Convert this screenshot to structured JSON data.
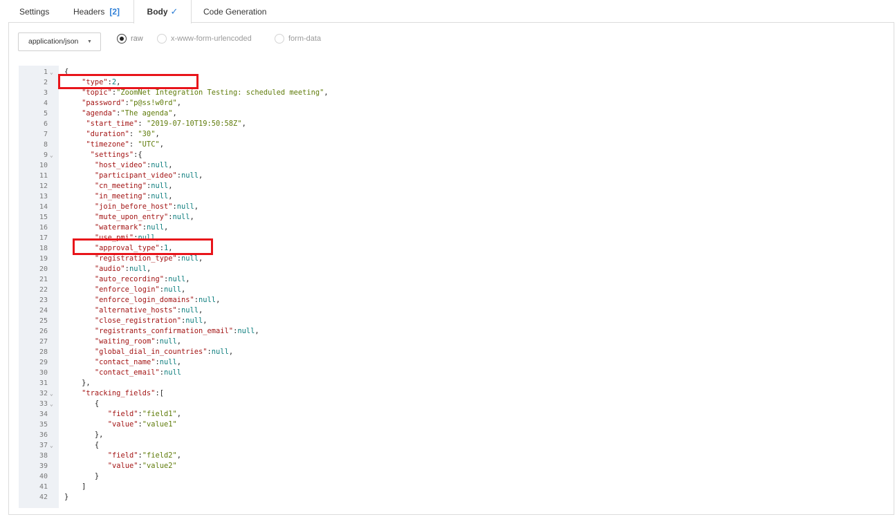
{
  "tabs": {
    "settings": "Settings",
    "headers": "Headers",
    "headers_count": "[2]",
    "body": "Body",
    "body_check": "✓",
    "code_generation": "Code Generation"
  },
  "body_options": {
    "content_type": "application/json",
    "raw": "raw",
    "urlencoded": "x-www-form-urlencoded",
    "form_data": "form-data",
    "selected": "raw"
  },
  "editor": {
    "lines": [
      {
        "n": "1",
        "fold": true,
        "indent": 0,
        "parts": [
          [
            "p",
            "{"
          ]
        ]
      },
      {
        "n": "2",
        "fold": false,
        "indent": 4,
        "parts": [
          [
            "k",
            "\"type\""
          ],
          [
            "p",
            ":"
          ],
          [
            "n",
            "2"
          ],
          [
            "p",
            ","
          ]
        ]
      },
      {
        "n": "3",
        "fold": false,
        "indent": 4,
        "parts": [
          [
            "k",
            "\"topic\""
          ],
          [
            "p",
            ":"
          ],
          [
            "s",
            "\"ZoomNet Integration Testing: scheduled meeting\""
          ],
          [
            "p",
            ","
          ]
        ]
      },
      {
        "n": "4",
        "fold": false,
        "indent": 4,
        "parts": [
          [
            "k",
            "\"password\""
          ],
          [
            "p",
            ":"
          ],
          [
            "s",
            "\"p@ss!w0rd\""
          ],
          [
            "p",
            ","
          ]
        ]
      },
      {
        "n": "5",
        "fold": false,
        "indent": 4,
        "parts": [
          [
            "k",
            "\"agenda\""
          ],
          [
            "p",
            ":"
          ],
          [
            "s",
            "\"The agenda\""
          ],
          [
            "p",
            ","
          ]
        ]
      },
      {
        "n": "6",
        "fold": false,
        "indent": 5,
        "parts": [
          [
            "k",
            "\"start_time\""
          ],
          [
            "p",
            ": "
          ],
          [
            "s",
            "\"2019-07-10T19:50:58Z\""
          ],
          [
            "p",
            ","
          ]
        ]
      },
      {
        "n": "7",
        "fold": false,
        "indent": 5,
        "parts": [
          [
            "k",
            "\"duration\""
          ],
          [
            "p",
            ": "
          ],
          [
            "s",
            "\"30\""
          ],
          [
            "p",
            ","
          ]
        ]
      },
      {
        "n": "8",
        "fold": false,
        "indent": 5,
        "parts": [
          [
            "k",
            "\"timezone\""
          ],
          [
            "p",
            ": "
          ],
          [
            "s",
            "\"UTC\""
          ],
          [
            "p",
            ","
          ]
        ]
      },
      {
        "n": "9",
        "fold": true,
        "indent": 6,
        "parts": [
          [
            "k",
            "\"settings\""
          ],
          [
            "p",
            ":{"
          ]
        ]
      },
      {
        "n": "10",
        "fold": false,
        "indent": 7,
        "parts": [
          [
            "k",
            "\"host_video\""
          ],
          [
            "p",
            ":"
          ],
          [
            "n",
            "null"
          ],
          [
            "p",
            ","
          ]
        ]
      },
      {
        "n": "11",
        "fold": false,
        "indent": 7,
        "parts": [
          [
            "k",
            "\"participant_video\""
          ],
          [
            "p",
            ":"
          ],
          [
            "n",
            "null"
          ],
          [
            "p",
            ","
          ]
        ]
      },
      {
        "n": "12",
        "fold": false,
        "indent": 7,
        "parts": [
          [
            "k",
            "\"cn_meeting\""
          ],
          [
            "p",
            ":"
          ],
          [
            "n",
            "null"
          ],
          [
            "p",
            ","
          ]
        ]
      },
      {
        "n": "13",
        "fold": false,
        "indent": 7,
        "parts": [
          [
            "k",
            "\"in_meeting\""
          ],
          [
            "p",
            ":"
          ],
          [
            "n",
            "null"
          ],
          [
            "p",
            ","
          ]
        ]
      },
      {
        "n": "14",
        "fold": false,
        "indent": 7,
        "parts": [
          [
            "k",
            "\"join_before_host\""
          ],
          [
            "p",
            ":"
          ],
          [
            "n",
            "null"
          ],
          [
            "p",
            ","
          ]
        ]
      },
      {
        "n": "15",
        "fold": false,
        "indent": 7,
        "parts": [
          [
            "k",
            "\"mute_upon_entry\""
          ],
          [
            "p",
            ":"
          ],
          [
            "n",
            "null"
          ],
          [
            "p",
            ","
          ]
        ]
      },
      {
        "n": "16",
        "fold": false,
        "indent": 7,
        "parts": [
          [
            "k",
            "\"watermark\""
          ],
          [
            "p",
            ":"
          ],
          [
            "n",
            "null"
          ],
          [
            "p",
            ","
          ]
        ]
      },
      {
        "n": "17",
        "fold": false,
        "indent": 7,
        "parts": [
          [
            "k",
            "\"use_pmi\""
          ],
          [
            "p",
            ":"
          ],
          [
            "n",
            "null"
          ],
          [
            "p",
            ","
          ]
        ]
      },
      {
        "n": "18",
        "fold": false,
        "indent": 7,
        "parts": [
          [
            "k",
            "\"approval_type\""
          ],
          [
            "p",
            ":"
          ],
          [
            "n",
            "1"
          ],
          [
            "p",
            ","
          ]
        ]
      },
      {
        "n": "19",
        "fold": false,
        "indent": 7,
        "parts": [
          [
            "k",
            "\"registration_type\""
          ],
          [
            "p",
            ":"
          ],
          [
            "n",
            "null"
          ],
          [
            "p",
            ","
          ]
        ]
      },
      {
        "n": "20",
        "fold": false,
        "indent": 7,
        "parts": [
          [
            "k",
            "\"audio\""
          ],
          [
            "p",
            ":"
          ],
          [
            "n",
            "null"
          ],
          [
            "p",
            ","
          ]
        ]
      },
      {
        "n": "21",
        "fold": false,
        "indent": 7,
        "parts": [
          [
            "k",
            "\"auto_recording\""
          ],
          [
            "p",
            ":"
          ],
          [
            "n",
            "null"
          ],
          [
            "p",
            ","
          ]
        ]
      },
      {
        "n": "22",
        "fold": false,
        "indent": 7,
        "parts": [
          [
            "k",
            "\"enforce_login\""
          ],
          [
            "p",
            ":"
          ],
          [
            "n",
            "null"
          ],
          [
            "p",
            ","
          ]
        ]
      },
      {
        "n": "23",
        "fold": false,
        "indent": 7,
        "parts": [
          [
            "k",
            "\"enforce_login_domains\""
          ],
          [
            "p",
            ":"
          ],
          [
            "n",
            "null"
          ],
          [
            "p",
            ","
          ]
        ]
      },
      {
        "n": "24",
        "fold": false,
        "indent": 7,
        "parts": [
          [
            "k",
            "\"alternative_hosts\""
          ],
          [
            "p",
            ":"
          ],
          [
            "n",
            "null"
          ],
          [
            "p",
            ","
          ]
        ]
      },
      {
        "n": "25",
        "fold": false,
        "indent": 7,
        "parts": [
          [
            "k",
            "\"close_registration\""
          ],
          [
            "p",
            ":"
          ],
          [
            "n",
            "null"
          ],
          [
            "p",
            ","
          ]
        ]
      },
      {
        "n": "26",
        "fold": false,
        "indent": 7,
        "parts": [
          [
            "k",
            "\"registrants_confirmation_email\""
          ],
          [
            "p",
            ":"
          ],
          [
            "n",
            "null"
          ],
          [
            "p",
            ","
          ]
        ]
      },
      {
        "n": "27",
        "fold": false,
        "indent": 7,
        "parts": [
          [
            "k",
            "\"waiting_room\""
          ],
          [
            "p",
            ":"
          ],
          [
            "n",
            "null"
          ],
          [
            "p",
            ","
          ]
        ]
      },
      {
        "n": "28",
        "fold": false,
        "indent": 7,
        "parts": [
          [
            "k",
            "\"global_dial_in_countries\""
          ],
          [
            "p",
            ":"
          ],
          [
            "n",
            "null"
          ],
          [
            "p",
            ","
          ]
        ]
      },
      {
        "n": "29",
        "fold": false,
        "indent": 7,
        "parts": [
          [
            "k",
            "\"contact_name\""
          ],
          [
            "p",
            ":"
          ],
          [
            "n",
            "null"
          ],
          [
            "p",
            ","
          ]
        ]
      },
      {
        "n": "30",
        "fold": false,
        "indent": 7,
        "parts": [
          [
            "k",
            "\"contact_email\""
          ],
          [
            "p",
            ":"
          ],
          [
            "n",
            "null"
          ]
        ]
      },
      {
        "n": "31",
        "fold": false,
        "indent": 4,
        "parts": [
          [
            "p",
            "},"
          ]
        ]
      },
      {
        "n": "32",
        "fold": true,
        "indent": 4,
        "parts": [
          [
            "k",
            "\"tracking_fields\""
          ],
          [
            "p",
            ":["
          ]
        ]
      },
      {
        "n": "33",
        "fold": true,
        "indent": 7,
        "parts": [
          [
            "p",
            "{"
          ]
        ]
      },
      {
        "n": "34",
        "fold": false,
        "indent": 10,
        "parts": [
          [
            "k",
            "\"field\""
          ],
          [
            "p",
            ":"
          ],
          [
            "s",
            "\"field1\""
          ],
          [
            "p",
            ","
          ]
        ]
      },
      {
        "n": "35",
        "fold": false,
        "indent": 10,
        "parts": [
          [
            "k",
            "\"value\""
          ],
          [
            "p",
            ":"
          ],
          [
            "s",
            "\"value1\""
          ]
        ]
      },
      {
        "n": "36",
        "fold": false,
        "indent": 7,
        "parts": [
          [
            "p",
            "},"
          ]
        ]
      },
      {
        "n": "37",
        "fold": true,
        "indent": 7,
        "parts": [
          [
            "p",
            "{"
          ]
        ]
      },
      {
        "n": "38",
        "fold": false,
        "indent": 10,
        "parts": [
          [
            "k",
            "\"field\""
          ],
          [
            "p",
            ":"
          ],
          [
            "s",
            "\"field2\""
          ],
          [
            "p",
            ","
          ]
        ]
      },
      {
        "n": "39",
        "fold": false,
        "indent": 10,
        "parts": [
          [
            "k",
            "\"value\""
          ],
          [
            "p",
            ":"
          ],
          [
            "s",
            "\"value2\""
          ]
        ]
      },
      {
        "n": "40",
        "fold": false,
        "indent": 7,
        "parts": [
          [
            "p",
            "}"
          ]
        ]
      },
      {
        "n": "41",
        "fold": false,
        "indent": 4,
        "parts": [
          [
            "p",
            "]"
          ]
        ]
      },
      {
        "n": "42",
        "fold": false,
        "indent": 0,
        "parts": [
          [
            "p",
            "}"
          ]
        ]
      }
    ]
  },
  "colors": {
    "key": "#a31515",
    "string": "#5f7b0a",
    "number": "#0b7d7d",
    "highlight": "#e8141a",
    "accent": "#2f7fd6"
  },
  "icons": {
    "fold": "chevron-down-icon",
    "dropdown": "caret-down-icon",
    "check": "check-icon"
  }
}
